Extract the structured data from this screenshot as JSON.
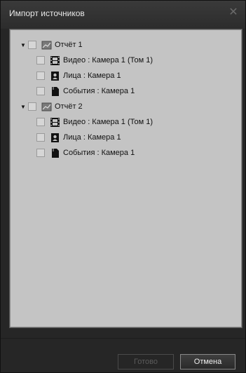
{
  "dialog": {
    "title": "Импорт источников",
    "close_symbol": "✕"
  },
  "tree": [
    {
      "label": "Отчёт 1",
      "icon": "report-icon",
      "expanded": true,
      "children": [
        {
          "label": "Видео : Камера 1 (Том 1)",
          "icon": "film-icon"
        },
        {
          "label": "Лица : Камера 1",
          "icon": "face-card-icon"
        },
        {
          "label": "События : Камера 1",
          "icon": "events-document-icon"
        }
      ]
    },
    {
      "label": "Отчёт 2",
      "icon": "report-icon",
      "expanded": true,
      "children": [
        {
          "label": "Видео : Камера 1 (Том 1)",
          "icon": "film-icon"
        },
        {
          "label": "Лица : Камера 1",
          "icon": "face-card-icon"
        },
        {
          "label": "События : Камера 1",
          "icon": "events-document-icon"
        }
      ]
    }
  ],
  "buttons": {
    "ok_label": "Готово",
    "cancel_label": "Отмена"
  }
}
